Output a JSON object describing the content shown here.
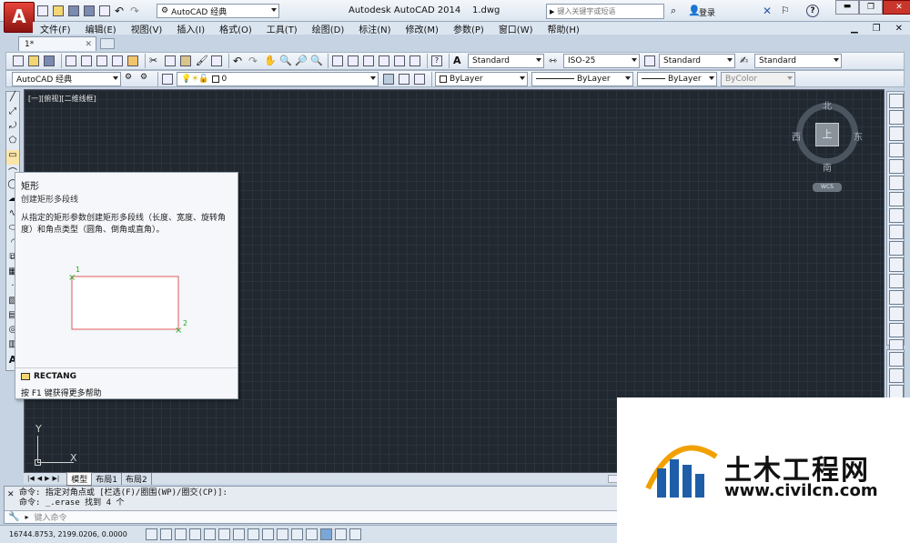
{
  "titlebar": {
    "workspace": "AutoCAD 经典",
    "title": "Autodesk AutoCAD 2014    1.dwg",
    "search_placeholder": "键入关键字或短语",
    "login": "登录",
    "help": "?"
  },
  "menu": [
    "文件(F)",
    "编辑(E)",
    "视图(V)",
    "插入(I)",
    "格式(O)",
    "工具(T)",
    "绘图(D)",
    "标注(N)",
    "修改(M)",
    "参数(P)",
    "窗口(W)",
    "帮助(H)"
  ],
  "doc_tab": "1*",
  "styles": {
    "text_style": "Standard",
    "dim_style": "ISO-25",
    "table_style": "Standard",
    "mleader_style": "Standard"
  },
  "layers": {
    "workspace": "AutoCAD 经典",
    "layer": "0",
    "color": "ByLayer",
    "linetype": "ByLayer",
    "lineweight": "ByLayer",
    "plotstyle": "ByColor"
  },
  "viewport_label": "[一][俯视][二维线框]",
  "viewcube": {
    "north": "北",
    "south": "南",
    "east": "东",
    "west": "西",
    "top": "上",
    "wcs": "WCS"
  },
  "tooltip": {
    "title": "矩形",
    "subtitle": "创建矩形多段线",
    "description": "从指定的矩形参数创建矩形多段线（长度、宽度、旋转角度）和角点类型（圆角、倒角或直角）。",
    "point1": "1",
    "point2": "2",
    "command": "RECTANG",
    "help": "按 F1 键获得更多帮助"
  },
  "ucs": {
    "x": "X",
    "y": "Y"
  },
  "layout_tabs": [
    "模型",
    "布局1",
    "布局2"
  ],
  "command_lines": [
    "命令: 指定对角点或 [栏选(F)/圈围(WP)/圈交(CP)]:",
    "命令: _.erase 找到 4 个"
  ],
  "command_placeholder": "键入命令",
  "coords": "16744.8753,  2199.0206,  0.0000",
  "watermark": {
    "brand": "土木工程网",
    "url": "www.civilcn.com"
  },
  "colors": {
    "canvas": "#212830",
    "grid": "#2b333c",
    "accent": "#d43a2f",
    "tooltip_rect": "#e05a5a",
    "point_marker": "#22aa22"
  }
}
